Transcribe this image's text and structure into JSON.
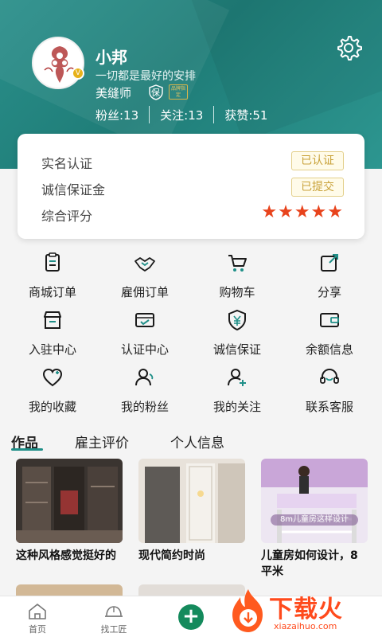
{
  "profile": {
    "name": "小邦",
    "motto": "一切都是最好的安排",
    "role": "美缝师",
    "bao_label": "保",
    "brand_label": "品牌指定",
    "stats": {
      "fans": "粉丝:13",
      "following": "关注:13",
      "likes": "获赞:51"
    }
  },
  "cert": {
    "real_name_label": "实名认证",
    "real_name_status": "已认证",
    "deposit_label": "诚信保证金",
    "deposit_status": "已提交",
    "rating_label": "综合评分",
    "rating_stars": "★★★★★",
    "rating_value": 5
  },
  "grid": {
    "items": [
      {
        "label": "商城订单",
        "icon": "clipboard-icon"
      },
      {
        "label": "雇佣订单",
        "icon": "handshake-icon"
      },
      {
        "label": "购物车",
        "icon": "cart-icon"
      },
      {
        "label": "分享",
        "icon": "share-icon"
      },
      {
        "label": "入驻中心",
        "icon": "store-icon"
      },
      {
        "label": "认证中心",
        "icon": "card-check-icon"
      },
      {
        "label": "诚信保证",
        "icon": "yen-shield-icon"
      },
      {
        "label": "余额信息",
        "icon": "wallet-icon"
      },
      {
        "label": "我的收藏",
        "icon": "heart-icon"
      },
      {
        "label": "我的粉丝",
        "icon": "user-fans-icon"
      },
      {
        "label": "我的关注",
        "icon": "user-follow-icon"
      },
      {
        "label": "联系客服",
        "icon": "headset-icon"
      }
    ]
  },
  "tabs": [
    "作品",
    "雇主评价",
    "个人信息"
  ],
  "works": [
    {
      "caption": "这种风格感觉挺好的"
    },
    {
      "caption": "现代简约时尚"
    },
    {
      "caption": "儿童房如何设计，8平米",
      "img_text": "8m儿童房这样设计"
    }
  ],
  "bottom_nav": {
    "home": "首页",
    "find": "找工匠"
  },
  "watermark": {
    "text": "下载火",
    "url": "xiazaihuo.com"
  },
  "colors": {
    "header": "#1f7d78",
    "accent": "#1f8f88",
    "star": "#e8431c",
    "tag": "#c9a23a",
    "plus": "#148a5c"
  }
}
